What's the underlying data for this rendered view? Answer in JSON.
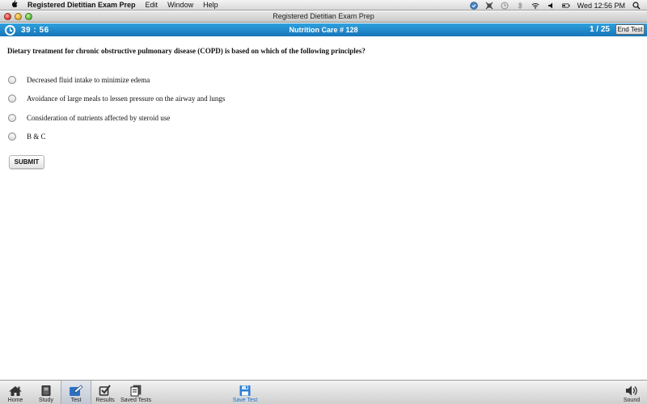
{
  "menubar": {
    "app_name": "Registered Dietitian Exam Prep",
    "items": [
      "Edit",
      "Window",
      "Help"
    ],
    "clock": "Wed 12:56 PM"
  },
  "window": {
    "title": "Registered Dietitian Exam Prep"
  },
  "header": {
    "timer": "39 : 56",
    "title": "Nutrition Care # 128",
    "progress": "1 / 25",
    "end_test_label": "End Test",
    "color": "#1e8ad0"
  },
  "question": {
    "text": "Dietary treatment for chronic obstructive pulmonary disease (COPD) is based on which of the following principles?",
    "options": [
      "Decreased fluid intake to minimize edema",
      "Avoidance of large meals to lessen pressure on the airway and lungs",
      "Consideration of nutrients affected by steroid use",
      "B & C"
    ],
    "submit_label": "SUBMIT"
  },
  "tabbar": {
    "tabs": [
      {
        "label": "Home",
        "icon": "home-icon"
      },
      {
        "label": "Study",
        "icon": "book-icon"
      },
      {
        "label": "Test",
        "icon": "pencil-icon",
        "active": true
      },
      {
        "label": "Results",
        "icon": "checkbox-icon"
      },
      {
        "label": "Saved Tests",
        "icon": "documents-icon"
      },
      {
        "label": "Save Test",
        "icon": "floppy-icon"
      },
      {
        "label": "Sound",
        "icon": "speaker-icon"
      }
    ]
  }
}
